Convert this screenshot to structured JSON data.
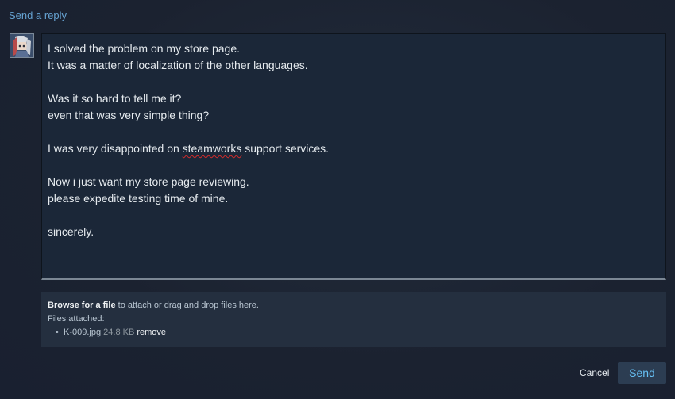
{
  "reply": {
    "title": "Send a reply"
  },
  "message": {
    "paragraphs": [
      {
        "lines": [
          "I solved the problem on my store page.",
          "It was a matter of localization of the other languages."
        ]
      },
      {
        "lines": [
          "Was it so hard to tell me it?",
          "even that was very simple thing?"
        ]
      },
      {
        "before": "I was very disappointed on ",
        "misspelled": "steamworks",
        "after": " support services."
      },
      {
        "lines": [
          "Now i just want my store page reviewing.",
          "please expedite testing time of mine."
        ]
      },
      {
        "lines": [
          "sincerely."
        ]
      }
    ]
  },
  "attachments": {
    "browse_label": "Browse for a file",
    "instruction": " to attach or drag and drop files here.",
    "files_attached_label": "Files attached:",
    "files": [
      {
        "name": "K-009.jpg",
        "size": "24.8 KB",
        "remove_label": "remove"
      }
    ]
  },
  "actions": {
    "cancel_label": "Cancel",
    "send_label": "Send"
  }
}
